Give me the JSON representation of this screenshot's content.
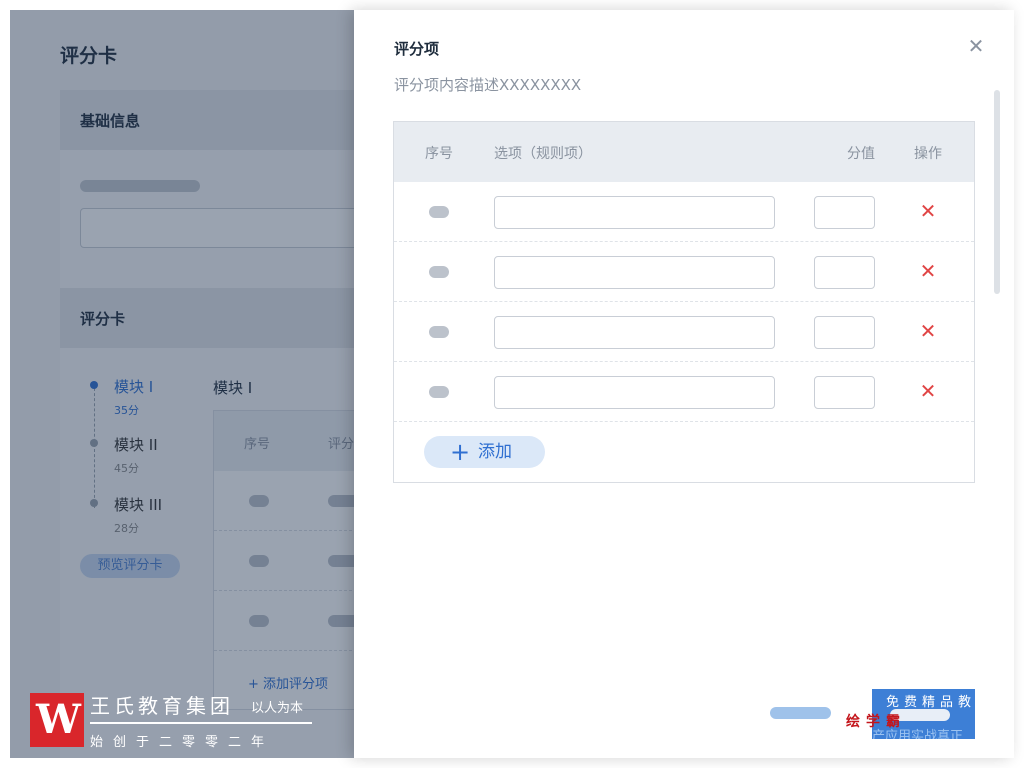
{
  "background": {
    "page_title": "评分卡",
    "section_basic": "基础信息",
    "section_scorecard": "评分卡",
    "modules": [
      {
        "name": "模块 I",
        "score": "35分",
        "active": true
      },
      {
        "name": "模块 II",
        "score": "45分",
        "active": false
      },
      {
        "name": "模块 III",
        "score": "28分",
        "active": false
      }
    ],
    "preview_button": "预览评分卡",
    "module_title": "模块 I",
    "table_headers": [
      "序号",
      "评分"
    ],
    "add_item_link": "+ 添加评分项"
  },
  "watermark": {
    "logo_letter": "W",
    "org_name": "王氏教育集团",
    "motto": "以人为本",
    "subtitle": "始创于二零零二年",
    "top_text": "免费精品教",
    "overlay_text": "绘学霸",
    "ghost_text": "产应用实战真正"
  },
  "drawer": {
    "title": "评分项",
    "description": "评分项内容描述XXXXXXXX",
    "close_icon": "close-icon",
    "table": {
      "headers": {
        "index": "序号",
        "option": "选项（规则项）",
        "score": "分值",
        "action": "操作"
      },
      "rows": [
        {},
        {},
        {},
        {}
      ]
    },
    "add_button": "添加",
    "add_icon": "plus-icon",
    "delete_icon": "delete-x-icon"
  },
  "colors": {
    "accent": "#2f6fd1",
    "danger": "#e04545",
    "brand_red": "#d9262b"
  }
}
